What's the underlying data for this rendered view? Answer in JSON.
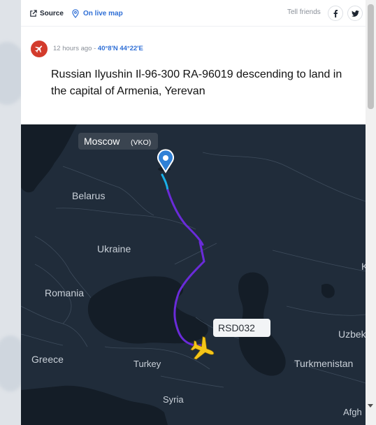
{
  "topbar": {
    "source_label": "Source",
    "livemap_label": "On live map",
    "tell_label": "Tell friends"
  },
  "post": {
    "time": "12 hours ago",
    "separator": "-",
    "coords": "40°8'N 44°22'E",
    "headline": "Russian Ilyushin Il-96-300 RA-96019 descending to land in the capital of Armenia, Yerevan"
  },
  "map": {
    "origin_city": "Moscow",
    "origin_code": "(VKO)",
    "callsign": "RSD032",
    "labels": {
      "belarus": "Belarus",
      "ukraine": "Ukraine",
      "romania": "Romania",
      "greece": "Greece",
      "turkey": "Turkey",
      "syria": "Syria",
      "uzbek": "Uzbek",
      "turkmenistan": "Turkmenistan",
      "afgh": "Afgh",
      "k": "K"
    },
    "colors": {
      "sea": "#15202b",
      "land": "#1e2a38",
      "route": "#6a2bd9",
      "plane": "#f5c518",
      "pin": "#2f80d6"
    }
  },
  "icons": {
    "source": "external-link-icon",
    "livemap": "map-pin-icon",
    "facebook": "facebook-icon",
    "twitter": "twitter-icon",
    "avatar": "airplane-icon",
    "plane": "airplane-icon"
  }
}
